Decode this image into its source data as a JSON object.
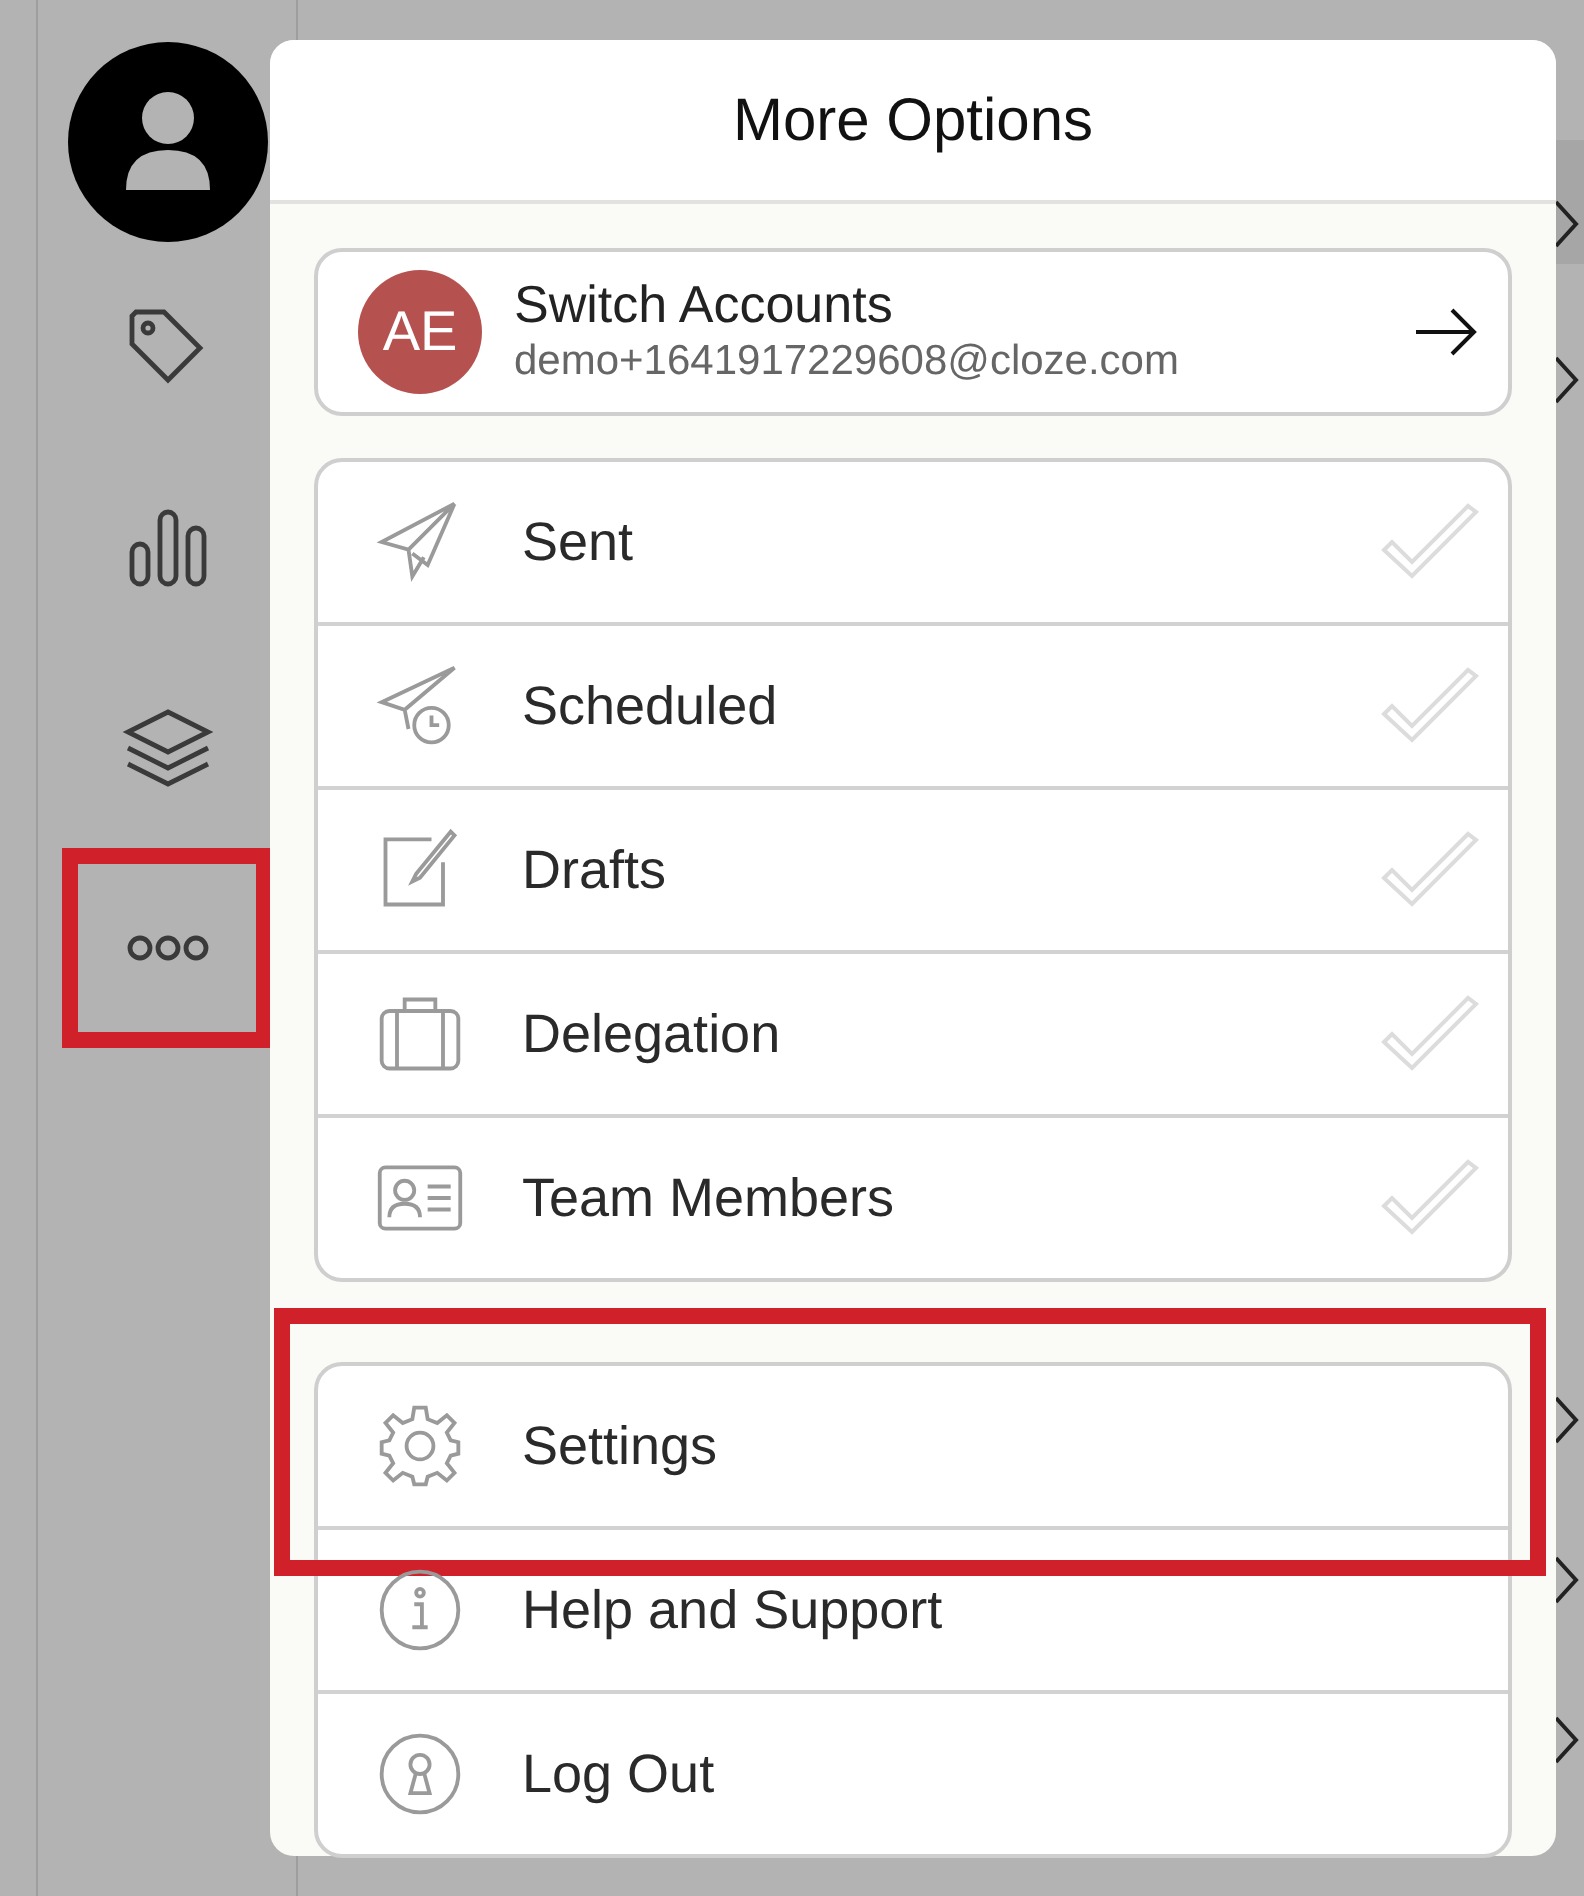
{
  "sidebar": {
    "items": [
      {
        "kind": "avatar",
        "highlighted": false
      },
      {
        "kind": "tag",
        "highlighted": false
      },
      {
        "kind": "chart",
        "highlighted": false
      },
      {
        "kind": "layers",
        "highlighted": false
      },
      {
        "kind": "more",
        "highlighted": true
      }
    ]
  },
  "menu": {
    "title": "More Options",
    "account": {
      "initials": "AE",
      "name": "Switch Accounts",
      "email": "demo+1641917229608@cloze.com"
    },
    "groups": [
      {
        "items": [
          {
            "kind": "sent",
            "label": "Sent",
            "checked": false,
            "highlighted": false
          },
          {
            "kind": "scheduled",
            "label": "Scheduled",
            "checked": false,
            "highlighted": false
          },
          {
            "kind": "drafts",
            "label": "Drafts",
            "checked": false,
            "highlighted": false
          },
          {
            "kind": "delegation",
            "label": "Delegation",
            "checked": false,
            "highlighted": false
          },
          {
            "kind": "team",
            "label": "Team Members",
            "checked": false,
            "highlighted": false
          }
        ]
      },
      {
        "items": [
          {
            "kind": "settings",
            "label": "Settings",
            "highlighted": true
          },
          {
            "kind": "help",
            "label": "Help and Support",
            "highlighted": false
          },
          {
            "kind": "logout",
            "label": "Log Out",
            "highlighted": false
          }
        ]
      }
    ]
  }
}
